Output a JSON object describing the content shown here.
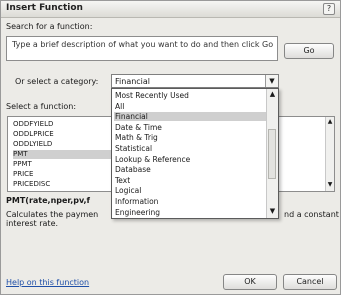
{
  "window": {
    "title": "Insert Function",
    "help_glyph": "?"
  },
  "search": {
    "label": "Search for a function:",
    "text": "Type a brief description of what you want to do and then click Go",
    "go_label": "Go"
  },
  "category": {
    "label": "Or select a category:",
    "value": "Financial",
    "options": [
      "Most Recently Used",
      "All",
      "Financial",
      "Date & Time",
      "Math & Trig",
      "Statistical",
      "Lookup & Reference",
      "Database",
      "Text",
      "Logical",
      "Information",
      "Engineering"
    ],
    "selected": "Financial"
  },
  "functions": {
    "label": "Select a function:",
    "items": [
      "ODDFYIELD",
      "ODDLPRICE",
      "ODDLYIELD",
      "PMT",
      "PPMT",
      "PRICE",
      "PRICEDISC"
    ],
    "selected": "PMT"
  },
  "details": {
    "signature": "PMT(rate,nper,pv,f",
    "description": "Calculates the paymen",
    "description_tail": "nd a constant",
    "description_line2": "interest rate."
  },
  "footer": {
    "help_link": "Help on this function",
    "ok_label": "OK",
    "cancel_label": "Cancel"
  },
  "icons": {
    "dropdown_arrow": "chevron-down-icon",
    "scroll_up": "scroll-up-icon",
    "scroll_down": "scroll-down-icon"
  }
}
